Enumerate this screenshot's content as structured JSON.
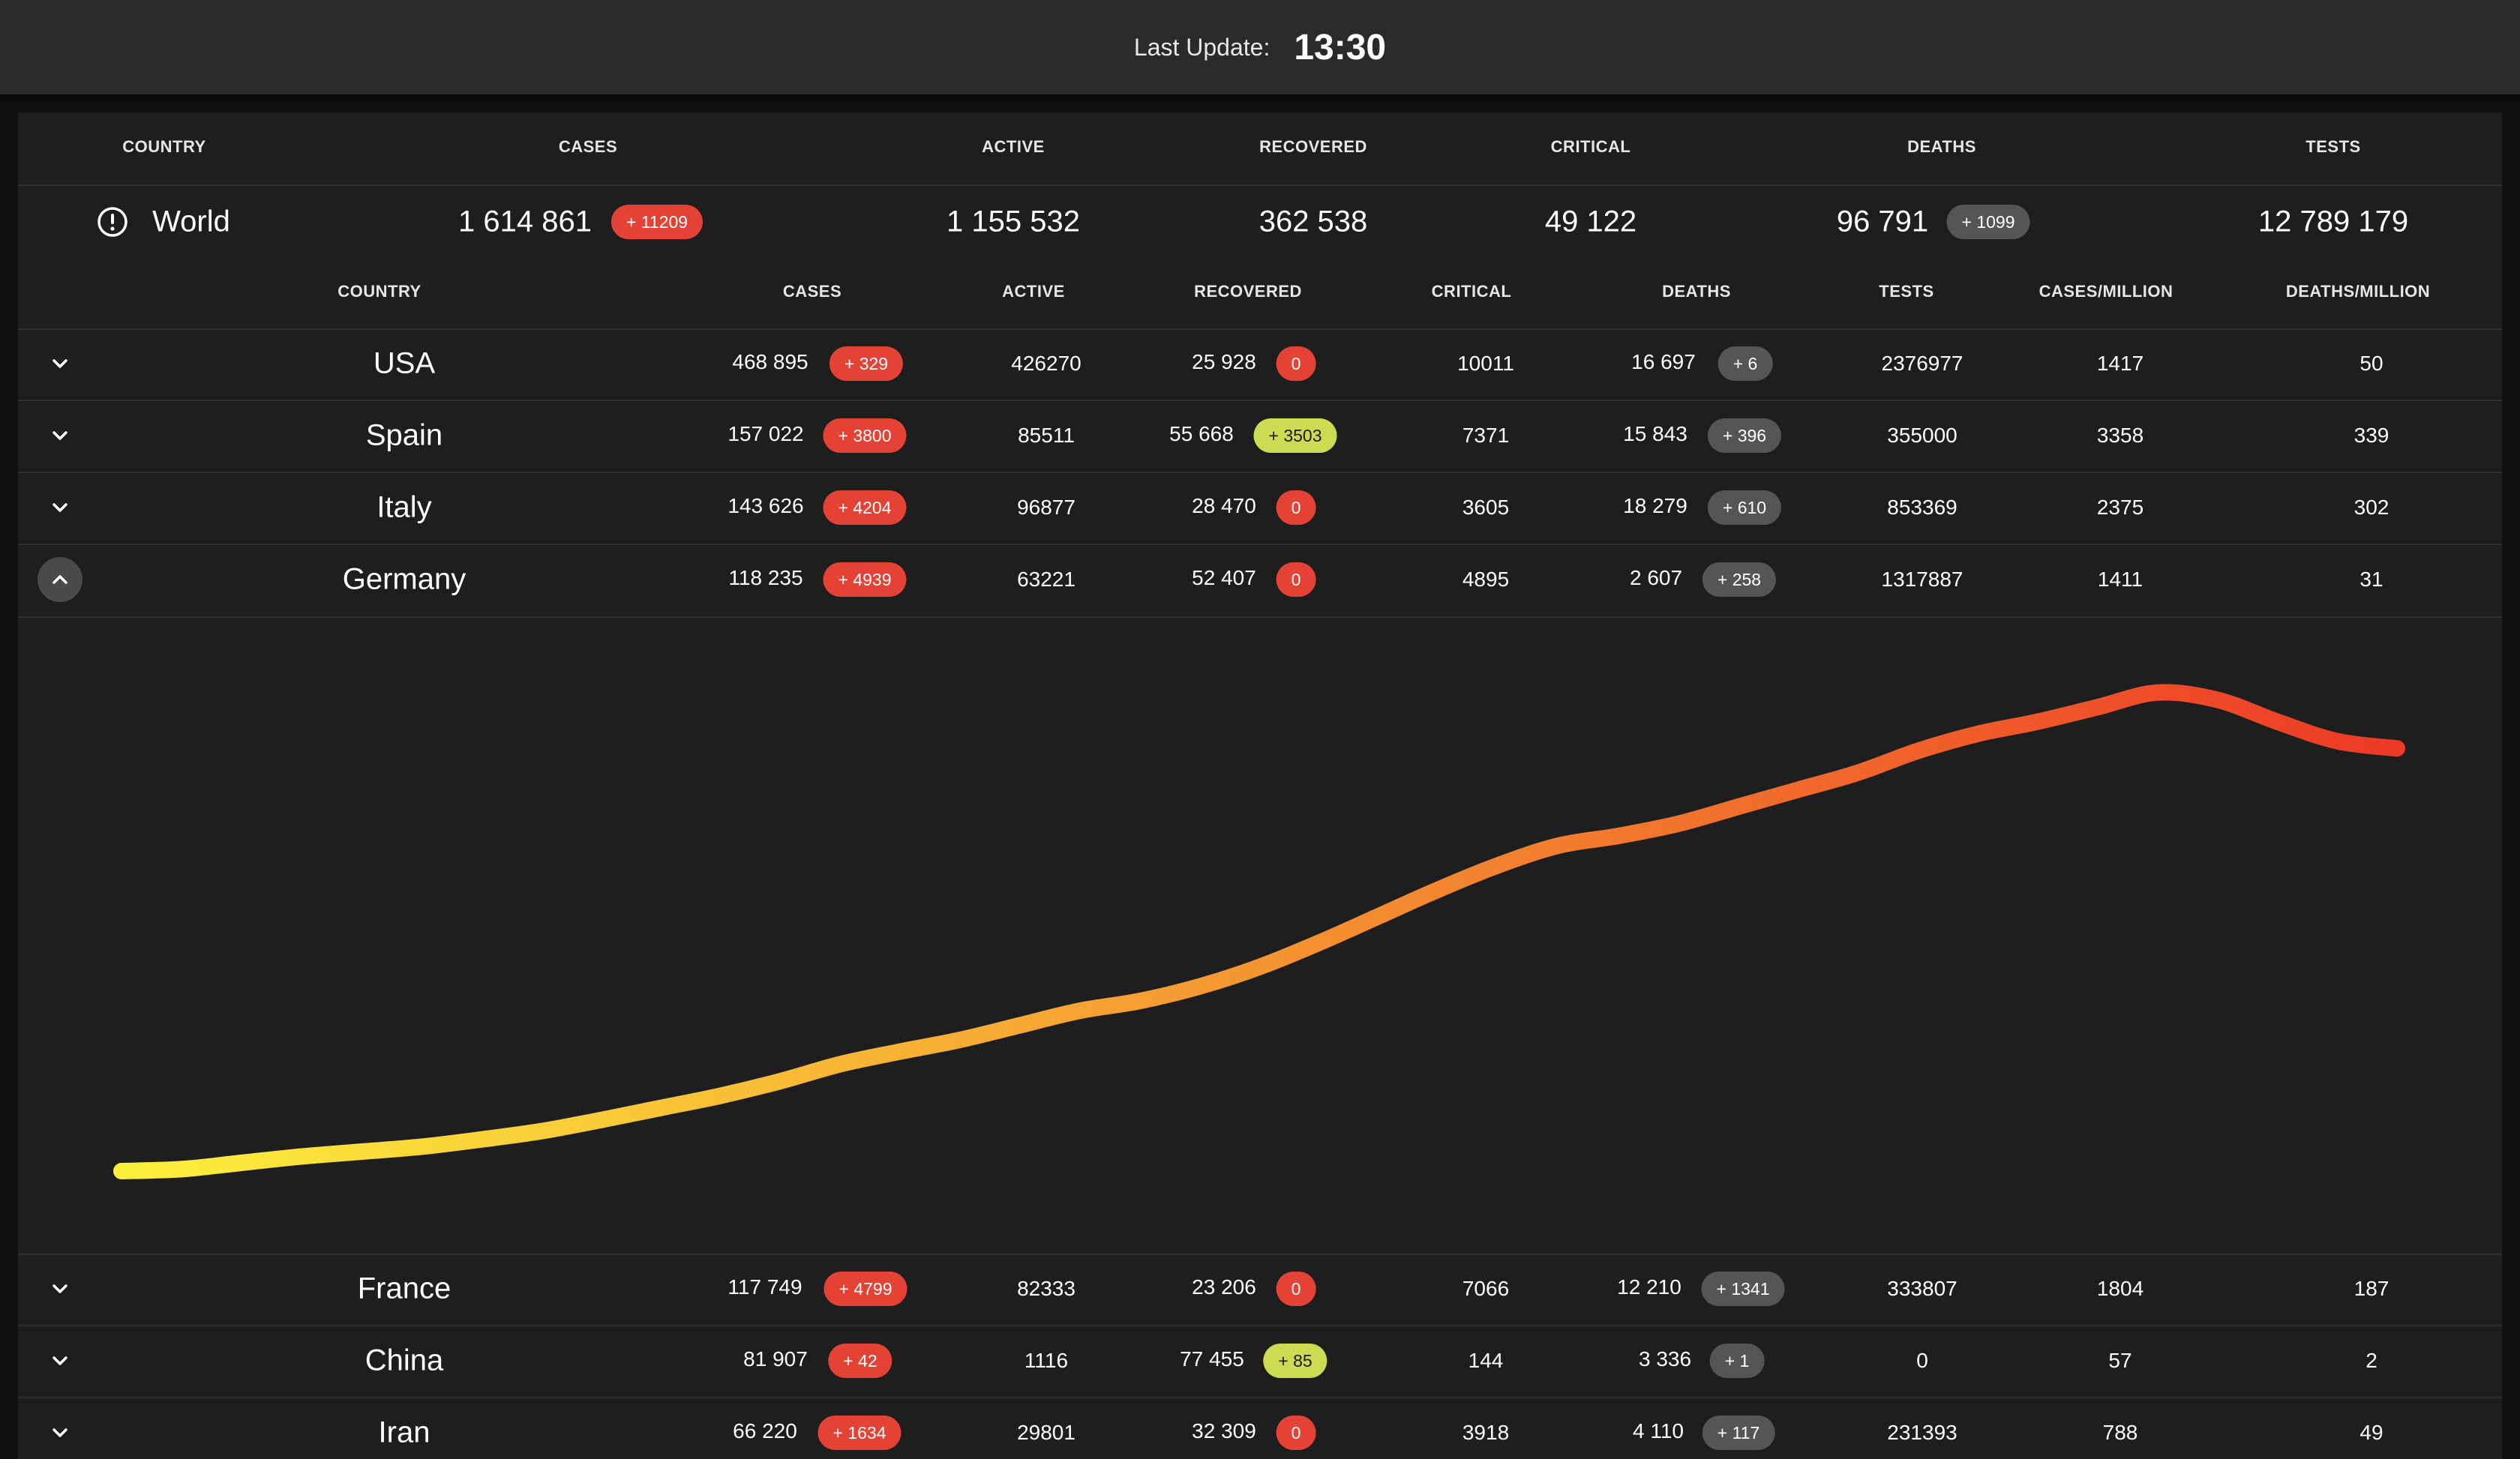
{
  "header": {
    "last_update_label": "Last Update:",
    "last_update_time": "13:30"
  },
  "world_table": {
    "columns": [
      "COUNTRY",
      "CASES",
      "ACTIVE",
      "RECOVERED",
      "CRITICAL",
      "DEATHS",
      "TESTS"
    ],
    "row": {
      "name": "World",
      "cases": "1 614 861",
      "cases_new": "+ 11209",
      "active": "1 155 532",
      "recovered": "362 538",
      "critical": "49 122",
      "deaths": "96 791",
      "deaths_new": "+ 1099",
      "tests": "12 789 179"
    }
  },
  "country_table": {
    "columns": [
      "COUNTRY",
      "CASES",
      "ACTIVE",
      "RECOVERED",
      "CRITICAL",
      "DEATHS",
      "TESTS",
      "CASES/MILLION",
      "DEATHS/MILLION"
    ],
    "rows": [
      {
        "country": "USA",
        "cases": "468 895",
        "cases_new": "+ 329",
        "active": "426270",
        "recovered": "25 928",
        "recovered_new": "0",
        "recovered_badge": "red",
        "critical": "10011",
        "deaths": "16 697",
        "deaths_new": "+ 6",
        "tests": "2376977",
        "cases_per_million": "1417",
        "deaths_per_million": "50",
        "expanded": false
      },
      {
        "country": "Spain",
        "cases": "157 022",
        "cases_new": "+ 3800",
        "active": "85511",
        "recovered": "55 668",
        "recovered_new": "+ 3503",
        "recovered_badge": "green",
        "critical": "7371",
        "deaths": "15 843",
        "deaths_new": "+ 396",
        "tests": "355000",
        "cases_per_million": "3358",
        "deaths_per_million": "339",
        "expanded": false
      },
      {
        "country": "Italy",
        "cases": "143 626",
        "cases_new": "+ 4204",
        "active": "96877",
        "recovered": "28 470",
        "recovered_new": "0",
        "recovered_badge": "red",
        "critical": "3605",
        "deaths": "18 279",
        "deaths_new": "+ 610",
        "tests": "853369",
        "cases_per_million": "2375",
        "deaths_per_million": "302",
        "expanded": false
      },
      {
        "country": "Germany",
        "cases": "118 235",
        "cases_new": "+ 4939",
        "active": "63221",
        "recovered": "52 407",
        "recovered_new": "0",
        "recovered_badge": "red",
        "critical": "4895",
        "deaths": "2 607",
        "deaths_new": "+ 258",
        "tests": "1317887",
        "cases_per_million": "1411",
        "deaths_per_million": "31",
        "expanded": true
      },
      {
        "country": "France",
        "cases": "117 749",
        "cases_new": "+ 4799",
        "active": "82333",
        "recovered": "23 206",
        "recovered_new": "0",
        "recovered_badge": "red",
        "critical": "7066",
        "deaths": "12 210",
        "deaths_new": "+ 1341",
        "tests": "333807",
        "cases_per_million": "1804",
        "deaths_per_million": "187",
        "expanded": false
      },
      {
        "country": "China",
        "cases": "81 907",
        "cases_new": "+ 42",
        "active": "1116",
        "recovered": "77 455",
        "recovered_new": "+ 85",
        "recovered_badge": "green",
        "critical": "144",
        "deaths": "3 336",
        "deaths_new": "+ 1",
        "tests": "0",
        "cases_per_million": "57",
        "deaths_per_million": "2",
        "expanded": false
      },
      {
        "country": "Iran",
        "cases": "66 220",
        "cases_new": "+ 1634",
        "active": "29801",
        "recovered": "32 309",
        "recovered_new": "0",
        "recovered_badge": "red",
        "critical": "3918",
        "deaths": "4 110",
        "deaths_new": "+ 117",
        "tests": "231393",
        "cases_per_million": "788",
        "deaths_per_million": "49",
        "expanded": false
      }
    ]
  },
  "icons": {
    "world": "alert-circle-icon",
    "collapsed": "chevron-down-icon",
    "expanded": "chevron-up-icon"
  },
  "colors": {
    "badge_red": "#e34234",
    "badge_gray": "#555555",
    "badge_green": "#c9dc52",
    "chart_gradient_start": "#fcf03c",
    "chart_gradient_end": "#ec3a26"
  },
  "chart_data": {
    "type": "line",
    "series": [
      {
        "values": [
          0.0,
          0.004,
          0.017,
          0.03,
          0.04,
          0.05,
          0.065,
          0.082,
          0.105,
          0.13,
          0.155,
          0.185,
          0.22,
          0.246,
          0.27,
          0.3,
          0.33,
          0.35,
          0.38,
          0.42,
          0.47,
          0.525,
          0.58,
          0.63,
          0.67,
          0.69,
          0.715,
          0.75,
          0.785,
          0.82,
          0.865,
          0.9,
          0.925,
          0.955,
          0.985,
          0.97,
          0.925,
          0.885,
          0.87
        ]
      }
    ],
    "ylim": [
      0,
      1
    ],
    "grid": false,
    "legend": "none"
  }
}
